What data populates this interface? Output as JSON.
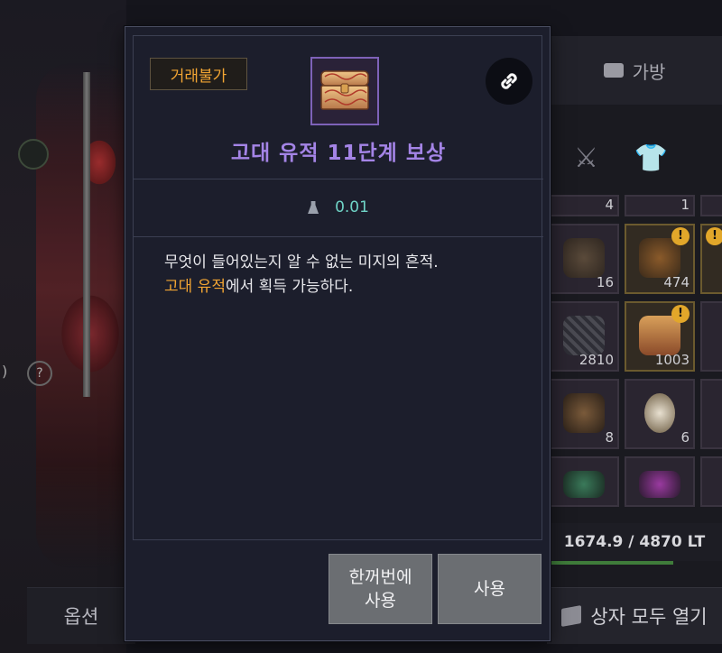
{
  "background": {
    "left_bottom_button": "옵션",
    "help_glyph": "?",
    "paren_glyph": ")",
    "bag_tab_label": "가방",
    "inventory_counts": [
      "4",
      "1",
      "16",
      "474",
      "2810",
      "1003",
      "8",
      "6"
    ],
    "weight_text": "1674.9 / 4870 LT",
    "open_all_button": "상자 모두 열기"
  },
  "tooltip": {
    "badge": "거래불가",
    "icons": {
      "item": "chest-icon",
      "link": "link-icon",
      "weight": "weight-icon"
    },
    "title": "고대 유적 11단계 보상",
    "weight_value": "0.01",
    "description_line1": "무엇이 들어있는지 알 수 없는 미지의 흔적.",
    "description_highlight": "고대 유적",
    "description_line2_rest": "에서 획득 가능하다.",
    "buttons": {
      "use_all_line1": "한꺼번에",
      "use_all_line2": "사용",
      "use": "사용"
    }
  },
  "colors": {
    "title": "#a484e6",
    "badge_text": "#f2a533",
    "highlight": "#f2a533",
    "weight_value": "#6fd3c6",
    "button_bg": "#6b6e72"
  }
}
